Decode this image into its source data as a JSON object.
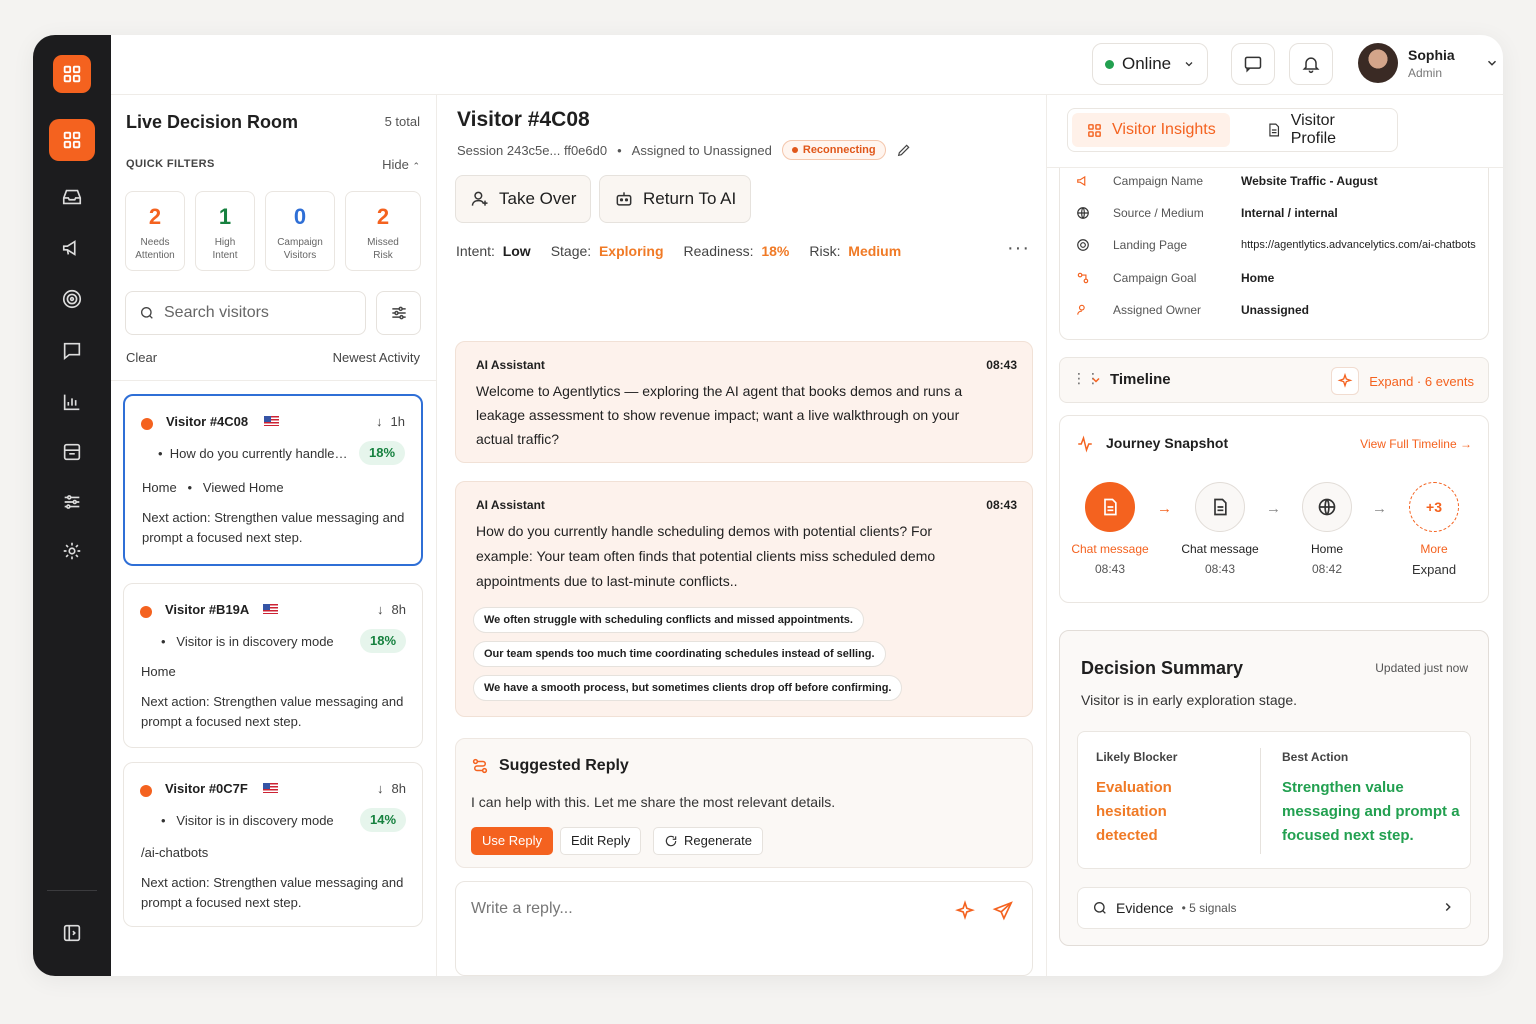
{
  "header": {
    "status": "Online",
    "user_name": "Sophia",
    "user_role": "Admin"
  },
  "left": {
    "title": "Live Decision Room",
    "total": "5 total",
    "filters_label": "QUICK FILTERS",
    "hide": "Hide",
    "stats": [
      {
        "num": "2",
        "label": "Needs Attention",
        "color": "#f4621f"
      },
      {
        "num": "1",
        "label": "High Intent",
        "color": "#16813f"
      },
      {
        "num": "0",
        "label": "Campaign Visitors",
        "color": "#2f6fd6"
      },
      {
        "num": "2",
        "label": "Missed Risk",
        "color": "#f4621f"
      }
    ],
    "search_placeholder": "Search visitors",
    "clear": "Clear",
    "sort": "Newest Activity",
    "visitors": [
      {
        "id": "Visitor #4C08",
        "time": "1h",
        "message": "How do you currently handle…",
        "pct": "18%",
        "page": "Home",
        "page2": "Viewed Home",
        "next": "Next action: Strengthen value messaging and prompt a focused next step."
      },
      {
        "id": "Visitor #B19A",
        "time": "8h",
        "message": "Visitor is in discovery mode",
        "pct": "18%",
        "page": "Home",
        "next": "Next action: Strengthen value messaging and prompt a focused next step."
      },
      {
        "id": "Visitor #0C7F",
        "time": "8h",
        "message": "Visitor is in discovery mode",
        "pct": "14%",
        "page": "/ai-chatbots",
        "next": "Next action: Strengthen value messaging and prompt a focused next step."
      }
    ]
  },
  "center": {
    "title": "Visitor #4C08",
    "session": "Session 243c5e... ff0e6d0",
    "assigned": "Assigned to Unassigned",
    "status_badge": "Reconnecting",
    "take_over": "Take Over",
    "return_ai": "Return To AI",
    "metrics": {
      "intent_label": "Intent:",
      "intent": "Low",
      "stage_label": "Stage:",
      "stage": "Exploring",
      "readiness_label": "Readiness:",
      "readiness": "18%",
      "risk_label": "Risk:",
      "risk": "Medium"
    },
    "messages": [
      {
        "who": "AI Assistant",
        "time": "08:43",
        "text": "Welcome to Agentlytics — exploring the AI agent that books demos and runs a leakage assessment to show revenue impact; want a live walkthrough on your actual traffic?"
      },
      {
        "who": "AI Assistant",
        "time": "08:43",
        "text": "How do you currently handle scheduling demos with potential clients? For example: Your team often finds that potential clients miss scheduled demo appointments due to last-minute conflicts..",
        "chips": [
          "We often struggle with scheduling conflicts and missed appointments.",
          "Our team spends too much time coordinating schedules instead of selling.",
          "We have a smooth process, but sometimes clients drop off before confirming."
        ]
      }
    ],
    "suggested": {
      "title": "Suggested Reply",
      "text": "I can help with this. Let me share the most relevant details.",
      "use": "Use Reply",
      "edit": "Edit Reply",
      "regen": "Regenerate"
    },
    "reply_placeholder": "Write a reply..."
  },
  "right": {
    "tab_insights": "Visitor Insights",
    "tab_profile": "Visitor Profile",
    "info": [
      {
        "key": "Campaign Name",
        "value": "Website Traffic - August",
        "icon": "megaphone-icon"
      },
      {
        "key": "Source / Medium",
        "value": "Internal / internal",
        "icon": "globe-icon"
      },
      {
        "key": "Landing Page",
        "value": "https://agentlytics.advancelytics.com/ai-chatbots",
        "icon": "target-icon"
      },
      {
        "key": "Campaign Goal",
        "value": "Home",
        "icon": "goal-icon"
      },
      {
        "key": "Assigned Owner",
        "value": "Unassigned",
        "icon": "user-icon"
      }
    ],
    "timeline": {
      "title": "Timeline",
      "expand": "Expand · 6 events"
    },
    "journey": {
      "title": "Journey Snapshot",
      "link": "View Full Timeline →",
      "nodes": [
        {
          "label": "Chat message",
          "time": "08:43"
        },
        {
          "label": "Chat message",
          "time": "08:43"
        },
        {
          "label": "Home",
          "time": "08:42"
        },
        {
          "label": "More",
          "time": "Expand",
          "badge": "+3"
        }
      ]
    },
    "decision": {
      "title": "Decision Summary",
      "updated": "Updated just now",
      "subtitle": "Visitor is in early exploration stage.",
      "blocker_label": "Likely Blocker",
      "blocker": "Evaluation hesitation detected",
      "action_label": "Best Action",
      "action": "Strengthen value messaging and prompt a focused next step.",
      "evidence": "Evidence",
      "signals": "• 5 signals"
    }
  }
}
